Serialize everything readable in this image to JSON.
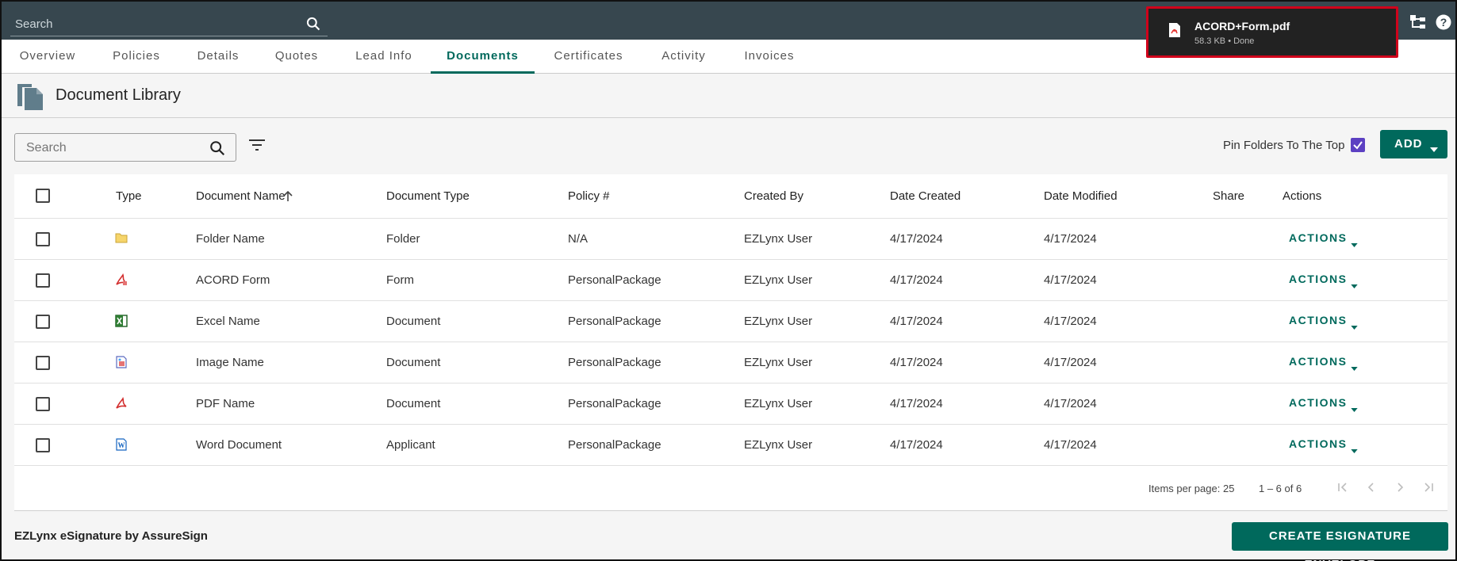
{
  "topbar": {
    "search_placeholder": "Search",
    "download": {
      "filename": "ACORD+Form.pdf",
      "meta": "58.3 KB • Done"
    }
  },
  "tabs": [
    {
      "label": "Overview"
    },
    {
      "label": "Policies"
    },
    {
      "label": "Details"
    },
    {
      "label": "Quotes"
    },
    {
      "label": "Lead Info"
    },
    {
      "label": "Documents",
      "active": true
    },
    {
      "label": "Certificates"
    },
    {
      "label": "Activity"
    },
    {
      "label": "Invoices"
    }
  ],
  "library": {
    "title": "Document Library"
  },
  "toolbar": {
    "search_placeholder": "Search",
    "pin_label": "Pin Folders To The Top",
    "pin_checked": true,
    "add_label": "ADD"
  },
  "table": {
    "headers": {
      "type": "Type",
      "name": "Document Name",
      "doctype": "Document Type",
      "policy": "Policy #",
      "created_by": "Created By",
      "date_created": "Date Created",
      "date_modified": "Date Modified",
      "share": "Share",
      "actions": "Actions"
    },
    "rows": [
      {
        "icon": "folder-icon",
        "name": "Folder Name",
        "doctype": "Folder",
        "policy": "N/A",
        "created_by": "EZLynx User",
        "date_created": "4/17/2024",
        "date_modified": "4/17/2024",
        "action": "ACTIONS"
      },
      {
        "icon": "acrobat-form-icon",
        "name": "ACORD Form",
        "doctype": "Form",
        "policy": "PersonalPackage",
        "created_by": "EZLynx User",
        "date_created": "4/17/2024",
        "date_modified": "4/17/2024",
        "action": "ACTIONS"
      },
      {
        "icon": "excel-icon",
        "name": "Excel Name",
        "doctype": "Document",
        "policy": "PersonalPackage",
        "created_by": "EZLynx User",
        "date_created": "4/17/2024",
        "date_modified": "4/17/2024",
        "action": "ACTIONS"
      },
      {
        "icon": "image-file-icon",
        "name": "Image Name",
        "doctype": "Document",
        "policy": "PersonalPackage",
        "created_by": "EZLynx User",
        "date_created": "4/17/2024",
        "date_modified": "4/17/2024",
        "action": "ACTIONS"
      },
      {
        "icon": "pdf-icon",
        "name": "PDF Name",
        "doctype": "Document",
        "policy": "PersonalPackage",
        "created_by": "EZLynx User",
        "date_created": "4/17/2024",
        "date_modified": "4/17/2024",
        "action": "ACTIONS"
      },
      {
        "icon": "word-icon",
        "name": "Word Document",
        "doctype": "Applicant",
        "policy": "PersonalPackage",
        "created_by": "EZLynx User",
        "date_created": "4/17/2024",
        "date_modified": "4/17/2024",
        "action": "ACTIONS"
      }
    ],
    "pager": {
      "items_label": "Items per page:",
      "items_value": "25",
      "range": "1 – 6 of 6"
    }
  },
  "footer": {
    "label": "EZLynx eSignature by AssureSign",
    "button": "CREATE ESIGNATURE ENVELOPE"
  },
  "colors": {
    "topbar": "#37474f",
    "accent": "#00695c",
    "checkbox": "#5c40c2",
    "highlight": "#d0021b"
  }
}
